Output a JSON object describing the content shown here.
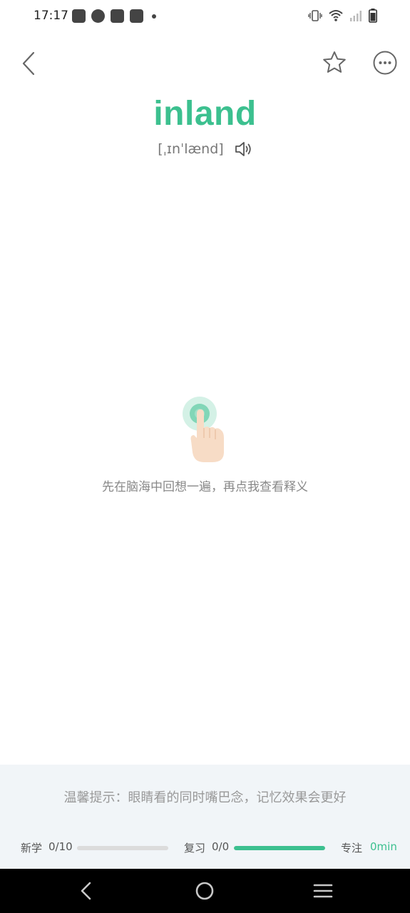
{
  "status_bar": {
    "time": "17:17",
    "notification_icons": [
      "bag-icon",
      "speedometer-icon",
      "bag-icon",
      "bag-icon"
    ],
    "system_icons": [
      "vibrate-icon",
      "wifi-icon",
      "signal-icon",
      "battery-icon"
    ]
  },
  "header": {
    "back_icon": "chevron-left-icon",
    "favorite_icon": "star-outline-icon",
    "more_icon": "more-horizontal-icon"
  },
  "word": {
    "text": "inland",
    "phonetic": "[ˌɪnˈlænd]",
    "speaker_icon": "speaker-icon"
  },
  "prompt": {
    "hint": "先在脑海中回想一遍，再点我查看释义",
    "icon": "tap-hand-icon"
  },
  "bottom": {
    "tip": "温馨提示：眼睛看的同时嘴巴念，记忆效果会更好",
    "new_label": "新学",
    "new_value": "0/10",
    "new_progress": 0.0,
    "review_label": "复习",
    "review_value": "0/0",
    "review_progress": 1.0,
    "focus_label": "专注",
    "focus_value": "0min"
  },
  "colors": {
    "accent": "#3cc08f",
    "panel_bg": "#f1f5f8",
    "bar_track": "#dcdcdc",
    "navbar_bg": "#000000"
  }
}
